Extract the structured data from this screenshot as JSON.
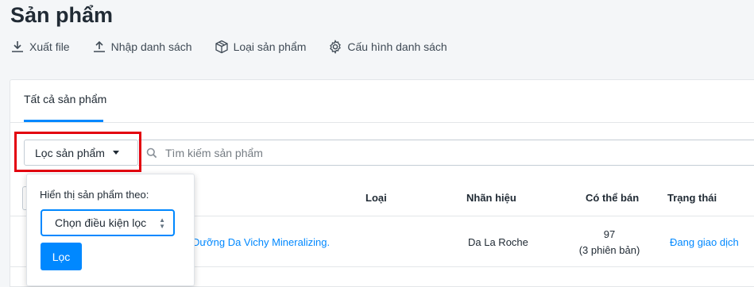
{
  "page": {
    "title": "Sản phẩm"
  },
  "toolbar": {
    "export_label": "Xuất file",
    "import_label": "Nhập danh sách",
    "product_type_label": "Loại sản phẩm",
    "config_label": "Cấu hình danh sách"
  },
  "tabs": {
    "all_label": "Tất cả sản phẩm"
  },
  "filter": {
    "button_label": "Lọc sản phẩm",
    "search_placeholder": "Tìm kiếm sản phẩm"
  },
  "table": {
    "headers": {
      "type": "Loại",
      "brand": "Nhãn hiệu",
      "available": "Có thể bán",
      "status": "Trạng thái"
    },
    "rows": [
      {
        "name": "Dưỡng Da Vichy Mineralizing.",
        "type": "",
        "brand": "Da La Roche",
        "available": "97",
        "variants": "(3 phiên bản)",
        "status": "Đang giao dịch"
      }
    ]
  },
  "popover": {
    "label": "Hiển thị sản phẩm theo:",
    "select_value": "Chọn điều kiện lọc",
    "apply_label": "Lọc"
  },
  "colors": {
    "accent": "#0088ff",
    "highlight": "#e3000f"
  }
}
